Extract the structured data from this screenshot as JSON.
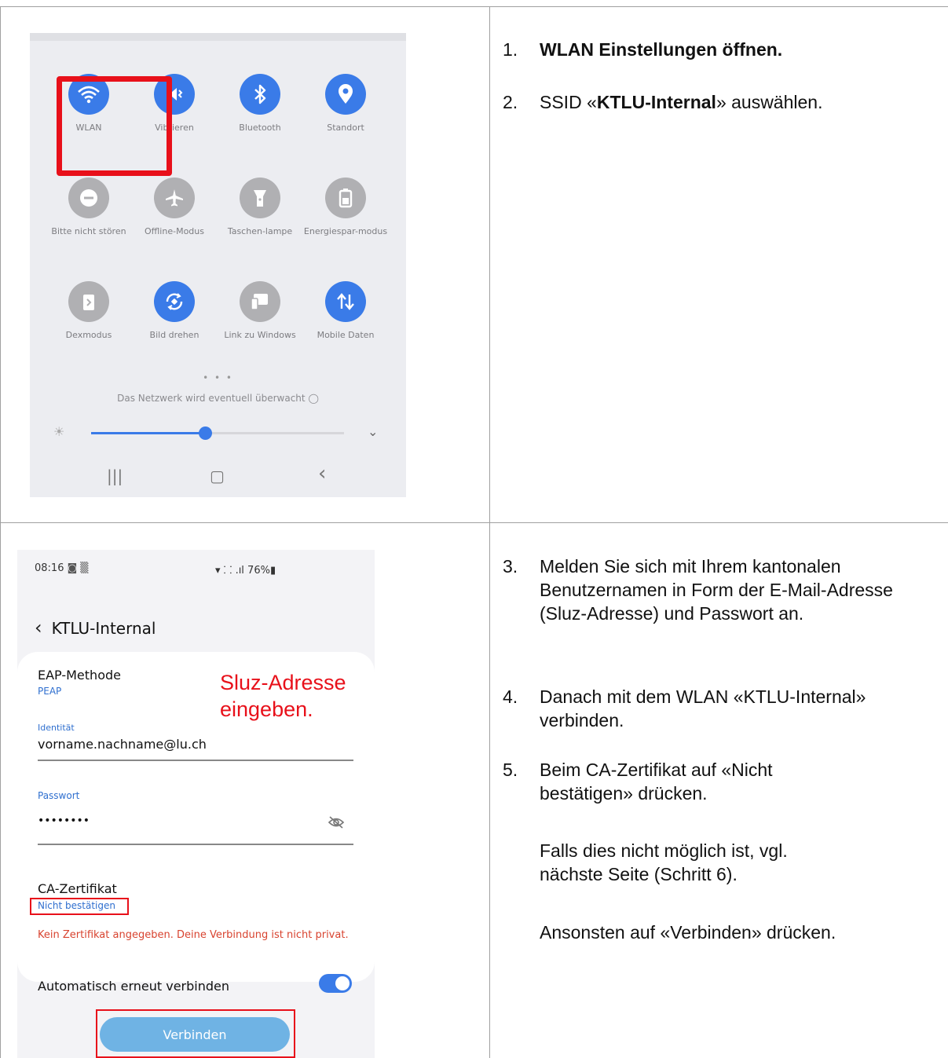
{
  "quick_settings": {
    "tiles": [
      {
        "label": "WLAN",
        "icon": "wifi-icon"
      },
      {
        "label": "Vibrieren",
        "icon": "vibrate-icon"
      },
      {
        "label": "Bluetooth",
        "icon": "bluetooth-icon"
      },
      {
        "label": "Standort",
        "icon": "location-icon"
      },
      {
        "label": "Bitte nicht stören",
        "icon": "do-not-disturb-icon"
      },
      {
        "label": "Offline-Modus",
        "icon": "airplane-icon"
      },
      {
        "label": "Taschen-lampe",
        "icon": "flashlight-icon"
      },
      {
        "label": "Energiespar-modus",
        "icon": "battery-saver-icon"
      },
      {
        "label": "Dexmodus",
        "icon": "dex-icon"
      },
      {
        "label": "Bild drehen",
        "icon": "rotate-icon"
      },
      {
        "label": "Link zu Windows",
        "icon": "link-windows-icon"
      },
      {
        "label": "Mobile Daten",
        "icon": "mobile-data-icon"
      }
    ],
    "pagination": "• • •",
    "network_message": "Das Netzwerk wird eventuell überwacht",
    "brightness_level": 0.45,
    "nav_recent": "|||",
    "nav_home": "▢",
    "nav_back": "‹"
  },
  "wlan_screen": {
    "time": "08:16",
    "status_icons": "◙ ▒",
    "signal": "▾ ⸬ .ıl 76%",
    "battery_icon": "▮",
    "network_title": "KTLU-Internal",
    "eap_label": "EAP-Methode",
    "eap_value": "PEAP",
    "identity_label": "Identität",
    "identity_value": "vorname.nachname@lu.ch",
    "password_label": "Passwort",
    "password_value": "••••••••",
    "cert_label": "CA-Zertifikat",
    "cert_value": "Nicht bestätigen",
    "cert_warning": "Kein Zertifikat angegeben. Deine Verbindung ist nicht privat.",
    "auto_reconnect_label": "Automatisch erneut verbinden",
    "auto_reconnect_on": true,
    "connect_button": "Verbinden",
    "annotation_line1": "Sluz-Adresse",
    "annotation_line2": "eingeben."
  },
  "instructions": {
    "step1_num": "1.",
    "step1": "WLAN Einstellungen öffnen.",
    "step2_num": "2.",
    "step2_pre": "SSID «",
    "step2_bold": "KTLU-Internal",
    "step2_post": "» auswählen.",
    "step3_num": "3.",
    "step3": "Melden Sie sich mit Ihrem kantonalen Benutzernamen in Form der E-Mail-Adresse (Sluz-Adresse) und Passwort an.",
    "step4_num": "4.",
    "step4": "Danach mit dem WLAN «KTLU-Internal» verbinden.",
    "step5_num": "5.",
    "step5": "Beim CA-Zertifikat auf «Nicht bestätigen» drücken.",
    "note1": "Falls dies nicht möglich ist, vgl. nächste Seite (Schritt 6).",
    "note2": "Ansonsten auf «Verbinden» drücken."
  }
}
